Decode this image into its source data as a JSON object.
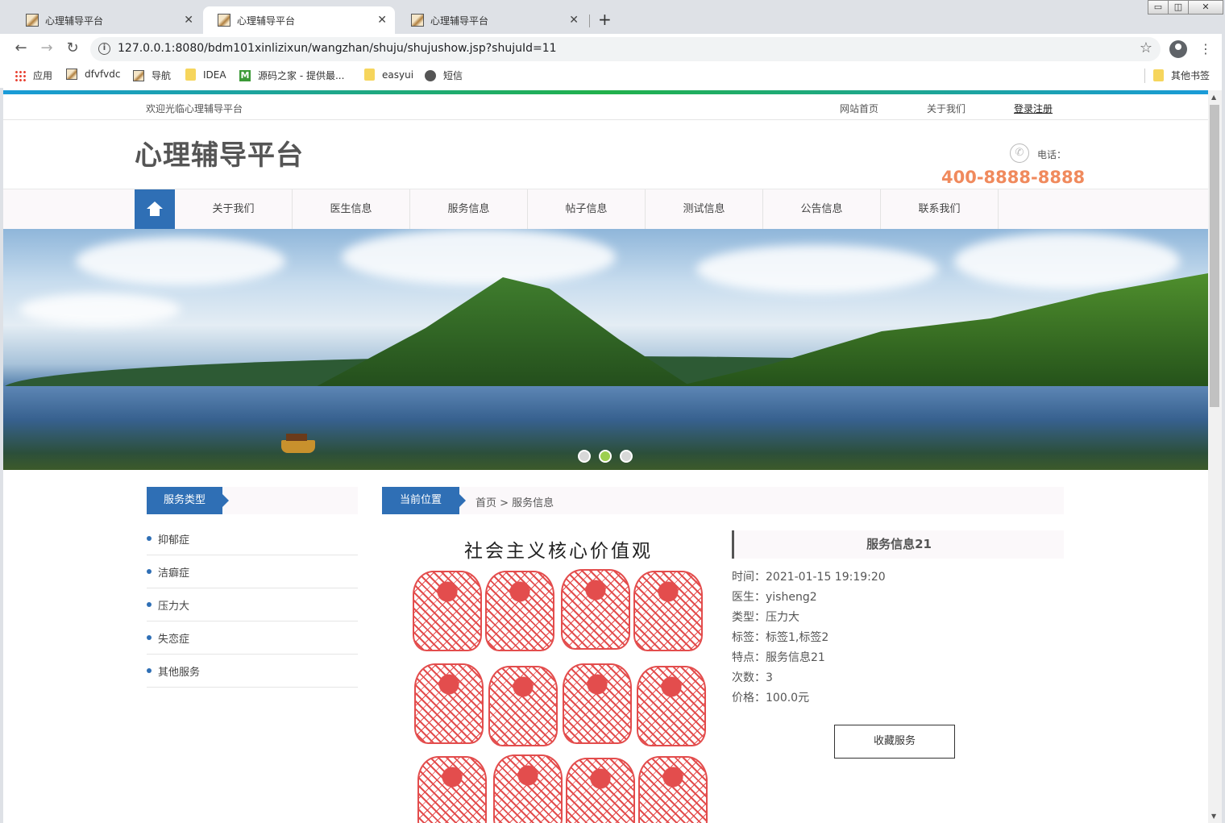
{
  "browser": {
    "tabs": [
      {
        "title": "心理辅导平台",
        "active": false
      },
      {
        "title": "心理辅导平台",
        "active": true
      },
      {
        "title": "心理辅导平台",
        "active": false
      }
    ],
    "new_tab_label": "+",
    "url": "127.0.0.1:8080/bdm101xinlizixun/wangzhan/shuju/shujushow.jsp?shujuId=11",
    "bookmarks": [
      {
        "label": "应用",
        "icon": "apps-icon"
      },
      {
        "label": "dfvfvdc",
        "icon": "page-icon"
      },
      {
        "label": "导航",
        "icon": "page-icon"
      },
      {
        "label": "IDEA",
        "icon": "folder-icon"
      },
      {
        "label": "源码之家 - 提供最...",
        "icon": "m-logo-icon"
      },
      {
        "label": "easyui",
        "icon": "folder-icon"
      },
      {
        "label": "短信",
        "icon": "globe-icon"
      }
    ],
    "other_bookmarks": "其他书签"
  },
  "site": {
    "welcome": "欢迎光临心理辅导平台",
    "top_links": [
      "网站首页",
      "关于我们",
      "登录注册"
    ],
    "logo": "心理辅导平台",
    "phone_label": "电话：",
    "phone_number": "400-8888-8888",
    "nav": [
      "关于我们",
      "医生信息",
      "服务信息",
      "帖子信息",
      "测试信息",
      "公告信息",
      "联系我们"
    ],
    "carousel_active_index": 2,
    "carousel_count": 3
  },
  "sidebar": {
    "title": "服务类型",
    "items": [
      "抑郁症",
      "洁癖症",
      "压力大",
      "失恋症",
      "其他服务"
    ]
  },
  "breadcrumb": {
    "tag": "当前位置",
    "path": "首页 > 服务信息"
  },
  "poster": {
    "title": "社会主义核心价值观"
  },
  "detail": {
    "title": "服务信息21",
    "rows": [
      "时间：2021-01-15 19:19:20",
      "医生：yisheng2",
      "类型：压力大",
      "标签：标签1,标签2",
      "特点：服务信息21",
      "次数：3",
      "价格：100.0元"
    ],
    "button": "收藏服务"
  },
  "colors": {
    "primary": "#2f6fb5",
    "phone": "#f08a5d"
  }
}
